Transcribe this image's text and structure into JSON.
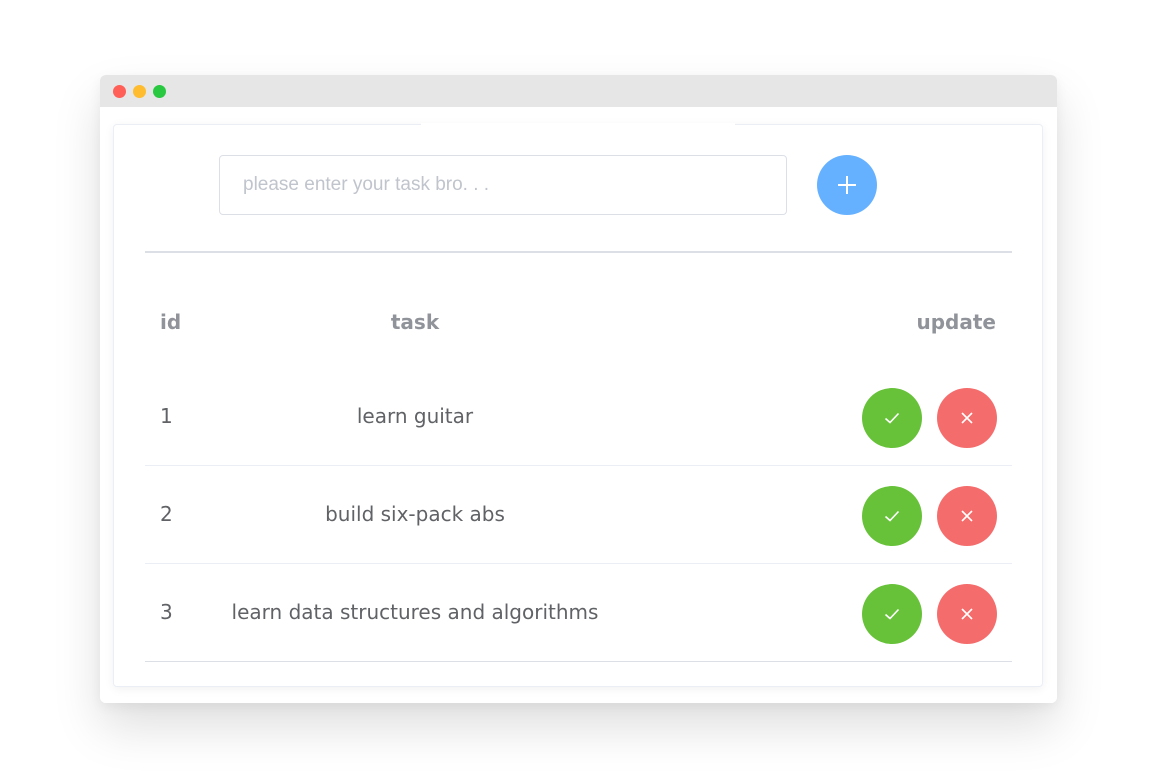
{
  "input": {
    "placeholder": "please enter your task bro. . .",
    "value": ""
  },
  "add_button": {
    "icon": "plus-icon",
    "color": "#66b1ff"
  },
  "table": {
    "headers": {
      "id": "id",
      "task": "task",
      "update": "update"
    },
    "rows": [
      {
        "id": "1",
        "task": "learn guitar"
      },
      {
        "id": "2",
        "task": "build six-pack abs"
      },
      {
        "id": "3",
        "task": "learn data structures and algorithms"
      }
    ],
    "actions": {
      "done": {
        "icon": "check-icon",
        "color": "#67c23a"
      },
      "delete": {
        "icon": "close-icon",
        "color": "#f56c6c"
      }
    }
  },
  "window": {
    "controls": [
      "close",
      "minimize",
      "maximize"
    ]
  }
}
